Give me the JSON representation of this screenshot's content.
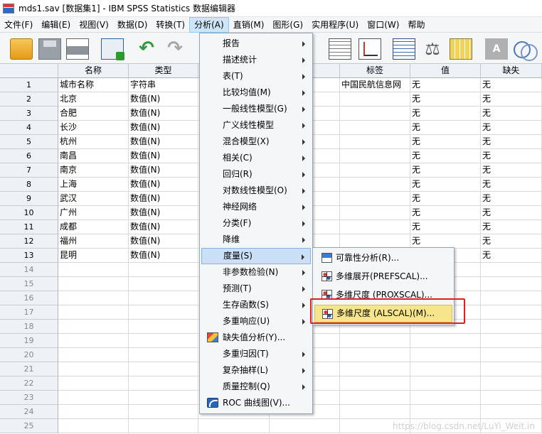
{
  "window": {
    "title": "mds1.sav [数据集1] - IBM SPSS Statistics 数据编辑器"
  },
  "menubar": [
    {
      "label": "文件(F)"
    },
    {
      "label": "编辑(E)"
    },
    {
      "label": "视图(V)"
    },
    {
      "label": "数据(D)"
    },
    {
      "label": "转换(T)"
    },
    {
      "label": "分析(A)"
    },
    {
      "label": "直销(M)"
    },
    {
      "label": "图形(G)"
    },
    {
      "label": "实用程序(U)"
    },
    {
      "label": "窗口(W)"
    },
    {
      "label": "帮助"
    }
  ],
  "toolbar": {
    "icons": [
      "open-folder-icon",
      "save-icon",
      "print-icon",
      "recall-dialog-icon",
      "undo-icon",
      "redo-icon",
      "goto-case-icon",
      "chart-builder-icon",
      "data-grid-icon",
      "weight-cases-icon",
      "value-labels-icon",
      "variable-sets-icon",
      "use-sets-icon"
    ]
  },
  "grid": {
    "columns": [
      {
        "label": "名称"
      },
      {
        "label": "类型"
      },
      {
        "label": ""
      },
      {
        "label": ""
      },
      {
        "label": "标签"
      },
      {
        "label": "值"
      },
      {
        "label": "缺失"
      }
    ],
    "rows": [
      {
        "num": "1",
        "name": "城市名称",
        "type": "字符串",
        "label": "中国民航信息网",
        "value": "无",
        "missing": "无"
      },
      {
        "num": "2",
        "name": "北京",
        "type": "数值(N)",
        "label": "",
        "value": "无",
        "missing": "无"
      },
      {
        "num": "3",
        "name": "合肥",
        "type": "数值(N)",
        "label": "",
        "value": "无",
        "missing": "无"
      },
      {
        "num": "4",
        "name": "长沙",
        "type": "数值(N)",
        "label": "",
        "value": "无",
        "missing": "无"
      },
      {
        "num": "5",
        "name": "杭州",
        "type": "数值(N)",
        "label": "",
        "value": "无",
        "missing": "无"
      },
      {
        "num": "6",
        "name": "南昌",
        "type": "数值(N)",
        "label": "",
        "value": "无",
        "missing": "无"
      },
      {
        "num": "7",
        "name": "南京",
        "type": "数值(N)",
        "label": "",
        "value": "无",
        "missing": "无"
      },
      {
        "num": "8",
        "name": "上海",
        "type": "数值(N)",
        "label": "",
        "value": "无",
        "missing": "无"
      },
      {
        "num": "9",
        "name": "武汉",
        "type": "数值(N)",
        "label": "",
        "value": "无",
        "missing": "无"
      },
      {
        "num": "10",
        "name": "广州",
        "type": "数值(N)",
        "label": "",
        "value": "无",
        "missing": "无"
      },
      {
        "num": "11",
        "name": "成都",
        "type": "数值(N)",
        "label": "",
        "value": "无",
        "missing": "无"
      },
      {
        "num": "12",
        "name": "福州",
        "type": "数值(N)",
        "label": "",
        "value": "无",
        "missing": "无"
      },
      {
        "num": "13",
        "name": "昆明",
        "type": "数值(N)",
        "label": "",
        "value": "",
        "missing": "无"
      }
    ],
    "empty_rows": [
      "14",
      "15",
      "16",
      "17",
      "18",
      "19",
      "20",
      "21",
      "22",
      "23",
      "24",
      "25"
    ]
  },
  "analyze_menu": [
    {
      "label": "报告",
      "submenu": true
    },
    {
      "label": "描述统计",
      "submenu": true
    },
    {
      "label": "表(T)",
      "submenu": true
    },
    {
      "label": "比较均值(M)",
      "submenu": true
    },
    {
      "label": "一般线性模型(G)",
      "submenu": true
    },
    {
      "label": "广义线性模型",
      "submenu": true
    },
    {
      "label": "混合模型(X)",
      "submenu": true
    },
    {
      "label": "相关(C)",
      "submenu": true
    },
    {
      "label": "回归(R)",
      "submenu": true
    },
    {
      "label": "对数线性模型(O)",
      "submenu": true
    },
    {
      "label": "神经网络",
      "submenu": true
    },
    {
      "label": "分类(F)",
      "submenu": true
    },
    {
      "label": "降维",
      "submenu": true
    },
    {
      "label": "度量(S)",
      "submenu": true,
      "active": true
    },
    {
      "label": "非参数检验(N)",
      "submenu": true
    },
    {
      "label": "预测(T)",
      "submenu": true
    },
    {
      "label": "生存函数(S)",
      "submenu": true
    },
    {
      "label": "多重响应(U)",
      "submenu": true
    },
    {
      "label": "缺失值分析(Y)...",
      "submenu": false,
      "icon": "missing-value-icon"
    },
    {
      "label": "多重归因(T)",
      "submenu": true
    },
    {
      "label": "复杂抽样(L)",
      "submenu": true
    },
    {
      "label": "质量控制(Q)",
      "submenu": true
    },
    {
      "label": "ROC 曲线图(V)...",
      "submenu": false,
      "icon": "roc-curve-icon"
    }
  ],
  "scale_submenu": [
    {
      "label": "可靠性分析(R)...",
      "icon": "reliability-icon"
    },
    {
      "label": "多维展开(PREFSCAL)...",
      "icon": "prefscal-icon"
    },
    {
      "label": "多维尺度 (PROXSCAL)...",
      "icon": "proxscal-icon"
    },
    {
      "label": "多维尺度 (ALSCAL)(M)...",
      "icon": "alscal-icon",
      "active": true
    }
  ],
  "watermark": "https://blog.csdn.net/LuYi_Weit.in"
}
